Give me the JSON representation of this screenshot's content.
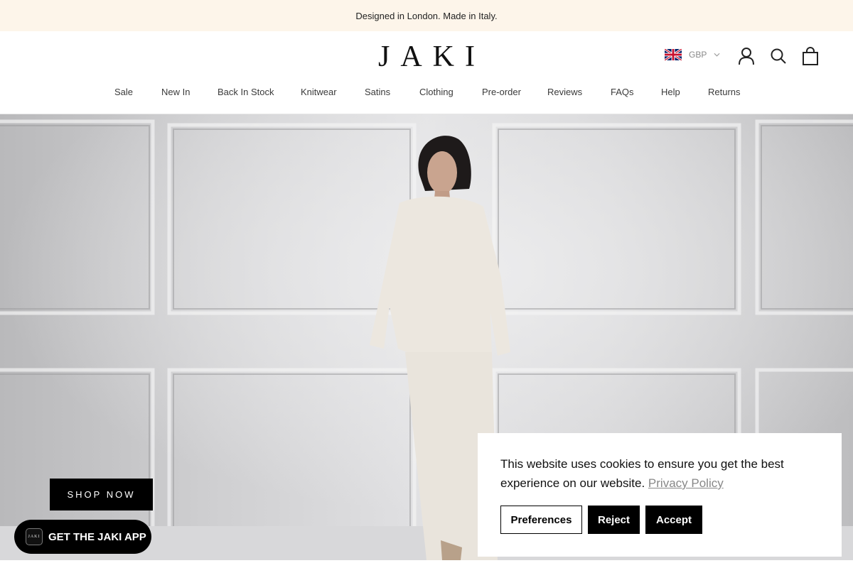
{
  "announcement": {
    "text": "Designed in London. Made in Italy."
  },
  "header": {
    "logo": "JAKI",
    "currency": {
      "code": "GBP",
      "flag_icon": "uk-flag-icon"
    },
    "icons": [
      "account-icon",
      "search-icon",
      "cart-icon"
    ]
  },
  "nav": {
    "items": [
      {
        "label": "Sale"
      },
      {
        "label": "New In"
      },
      {
        "label": "Back In Stock"
      },
      {
        "label": "Knitwear"
      },
      {
        "label": "Satins"
      },
      {
        "label": "Clothing"
      },
      {
        "label": "Pre-order"
      },
      {
        "label": "Reviews"
      },
      {
        "label": "FAQs"
      },
      {
        "label": "Help"
      },
      {
        "label": "Returns"
      }
    ]
  },
  "hero": {
    "cta": "SHOP NOW"
  },
  "app_banner": {
    "label": "GET THE JAKI APP",
    "logo_text": "JAKI"
  },
  "cookie_banner": {
    "text": "This website uses cookies to ensure you get the best experience on our website.",
    "link": "Privacy Policy",
    "buttons": {
      "preferences": "Preferences",
      "reject": "Reject",
      "accept": "Accept"
    }
  },
  "colors": {
    "announcement_bg": "#fdf5ea",
    "button_bg": "#000000",
    "link": "#888888"
  }
}
